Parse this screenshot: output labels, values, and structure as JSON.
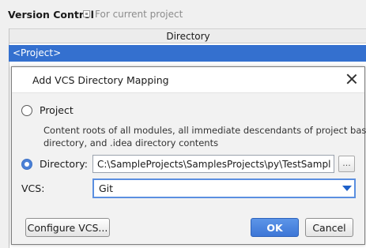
{
  "settings": {
    "title": "Version Control",
    "scope_label": "For current project",
    "table": {
      "columns": [
        "Directory"
      ],
      "rows": [
        "<Project>"
      ]
    }
  },
  "dialog": {
    "title": "Add VCS Directory Mapping",
    "project_option": {
      "label": "Project",
      "selected": false,
      "description_line1": "Content roots of all modules, all immediate descendants of project base",
      "description_line2": "directory, and .idea directory contents"
    },
    "directory_option": {
      "label": "Directory:",
      "selected": true,
      "value": "C:\\SampleProjects\\SamplesProjects\\py\\TestSamples",
      "browse_label": "..."
    },
    "vcs": {
      "label": "VCS:",
      "selected": "Git"
    },
    "buttons": {
      "configure": "Configure VCS...",
      "ok": "OK",
      "cancel": "Cancel"
    }
  },
  "colors": {
    "selection": "#3470cf",
    "accent": "#4a80d6"
  }
}
